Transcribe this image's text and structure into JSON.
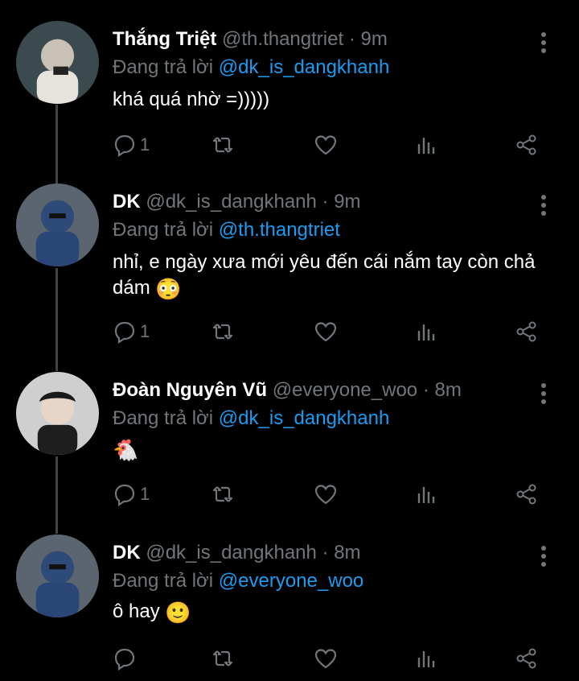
{
  "colors": {
    "background": "#000000",
    "mention": "#1d9bf0",
    "muted": "#71767b",
    "thread_line": "#3f4448"
  },
  "tweets": [
    {
      "name": "Thắng Triệt",
      "handle": "@th.thangtriet",
      "time": "· 9m",
      "replying_prefix": "Đang trả lời",
      "replying_to": "@dk_is_dangkhanh",
      "text": "khá quá nhờ =)))))",
      "emoji": "",
      "reply_count": "1",
      "icons": [
        "reply-icon",
        "retweet-icon",
        "like-icon",
        "views-icon",
        "share-icon"
      ]
    },
    {
      "name": "DK",
      "handle": "@dk_is_dangkhanh",
      "time": "· 9m",
      "replying_prefix": "Đang trả lời",
      "replying_to": "@th.thangtriet",
      "text": "nhỉ, e ngày xưa mới yêu đến cái nắm tay còn chả dám",
      "emoji": "😳",
      "reply_count": "1",
      "icons": [
        "reply-icon",
        "retweet-icon",
        "like-icon",
        "views-icon",
        "share-icon"
      ]
    },
    {
      "name": "Đoàn Nguyên Vũ",
      "handle": "@everyone_woo",
      "time": "· 8m",
      "replying_prefix": "Đang trả lời",
      "replying_to": "@dk_is_dangkhanh",
      "text": "",
      "emoji": "🐔",
      "reply_count": "1",
      "icons": [
        "reply-icon",
        "retweet-icon",
        "like-icon",
        "views-icon",
        "share-icon"
      ]
    },
    {
      "name": "DK",
      "handle": "@dk_is_dangkhanh",
      "time": "· 8m",
      "replying_prefix": "Đang trả lời",
      "replying_to": "@everyone_woo",
      "text": "ô hay",
      "emoji": "🙂",
      "reply_count": "",
      "icons": [
        "reply-icon",
        "retweet-icon",
        "like-icon",
        "views-icon",
        "share-icon"
      ]
    }
  ]
}
